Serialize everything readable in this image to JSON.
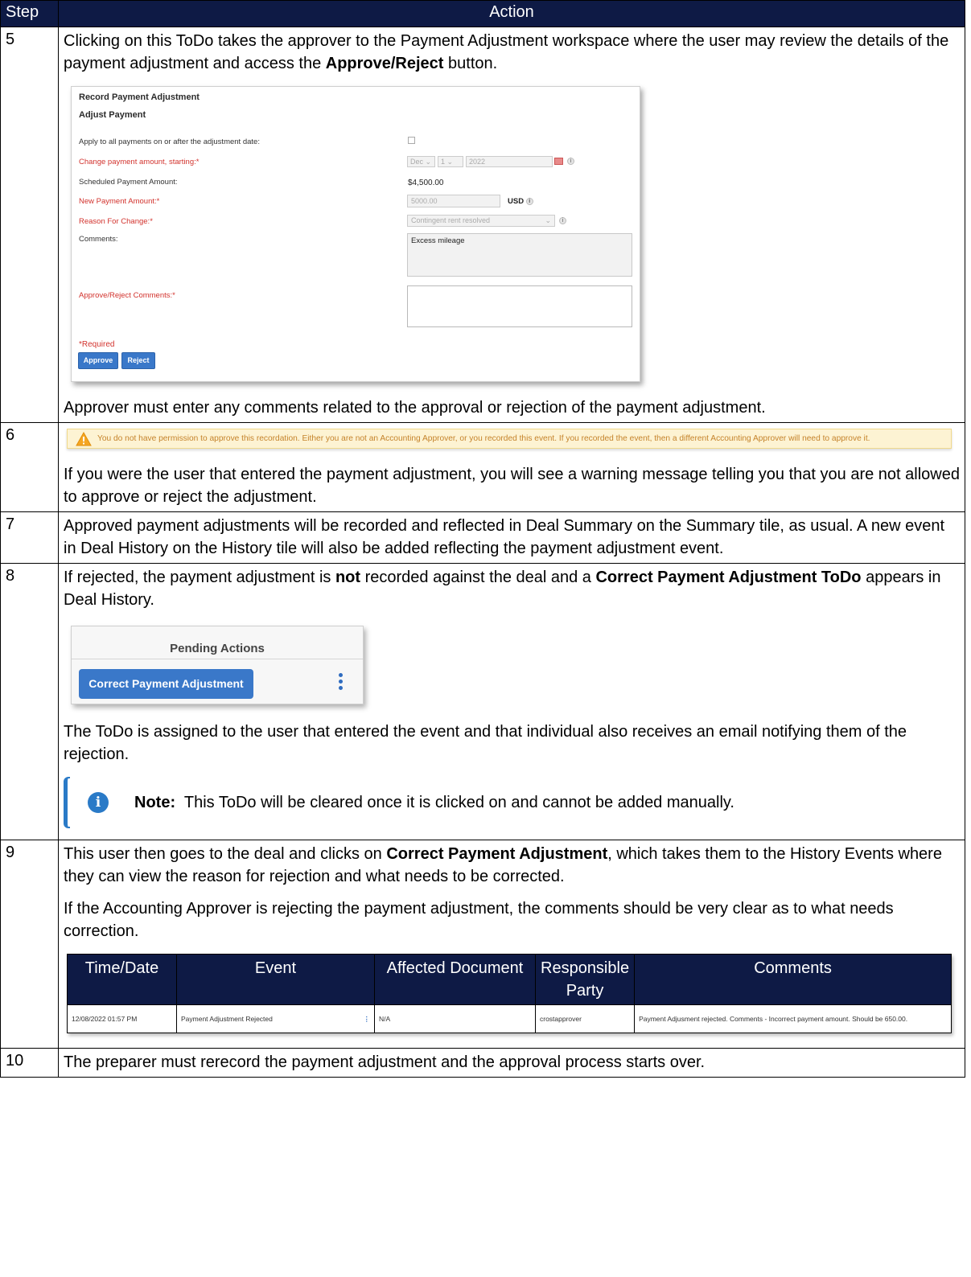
{
  "table": {
    "header_step": "Step",
    "header_action": "Action"
  },
  "steps": {
    "s5": {
      "num": "5",
      "p1_a": "Clicking on this ToDo takes the approver to the Payment Adjustment workspace where the user may review the details of the payment adjustment and access the ",
      "p1_b": "Approve/Reject",
      "p1_c": " button.",
      "p2": "Approver must enter any comments related to the approval or rejection of the payment adjustment."
    },
    "s6": {
      "num": "6",
      "p1": "If you were the user that entered the payment adjustment, you will see a warning message telling you that you are not allowed to approve or reject the adjustment."
    },
    "s7": {
      "num": "7",
      "p1": "Approved payment adjustments will be recorded and reflected in Deal Summary on the Summary tile, as usual. A new event in Deal History on the History tile will also be added reflecting the payment adjustment event."
    },
    "s8": {
      "num": "8",
      "p1_a": "If rejected, the payment adjustment is ",
      "p1_b": "not",
      "p1_c": " recorded against the deal and a ",
      "p1_d": "Correct Payment Adjustment ToDo",
      "p1_e": " appears in Deal History.",
      "p2": "The ToDo is assigned to the user that entered the event and that individual also receives an email notifying them of the rejection.",
      "note_label": "Note:",
      "note_text": "This ToDo will be cleared once it is clicked on and cannot be added manually."
    },
    "s9": {
      "num": "9",
      "p1_a": "This user then goes to the deal and clicks on ",
      "p1_b": "Correct Payment Adjustment",
      "p1_c": ", which takes them to the History Events where they can view the reason for rejection and what needs to be corrected.",
      "p2": "If the Accounting Approver is rejecting the payment adjustment, the comments should be very clear as to what needs correction."
    },
    "s10": {
      "num": "10",
      "p1": "The preparer must rerecord the payment adjustment and the approval process starts over."
    }
  },
  "adjust_form": {
    "title": "Record Payment Adjustment",
    "subtitle": "Adjust Payment",
    "apply_label": "Apply to all payments on or after the adjustment date:",
    "change_label": "Change payment amount, starting:*",
    "month": "Dec",
    "day": "1",
    "year": "2022",
    "scheduled_label": "Scheduled Payment Amount:",
    "scheduled_value": "$4,500.00",
    "new_amount_label": "New Payment Amount:*",
    "new_amount_value": "5000.00",
    "currency": "USD",
    "reason_label": "Reason For Change:*",
    "reason_value": "Contingent rent resolved",
    "comments_label": "Comments:",
    "comments_value": "Excess mileage",
    "approve_comments_label": "Approve/Reject Comments:*",
    "required": "*Required",
    "approve_btn": "Approve",
    "reject_btn": "Reject"
  },
  "warning": {
    "text": "You do not have permission to approve this recordation. Either you are not an Accounting Approver, or you recorded this event. If you recorded the event, then a different Accounting Approver will need to approve it."
  },
  "pending": {
    "title": "Pending Actions",
    "button": "Correct Payment Adjustment"
  },
  "history": {
    "headers": [
      "Time/Date",
      "Event",
      "Affected Document",
      "Responsible Party",
      "Comments"
    ],
    "row": [
      "12/08/2022 01:57 PM",
      "Payment Adjustment Rejected",
      "N/A",
      "crostapprover",
      "Payment Adjusment rejected. Comments - Incorrect payment amount. Should be 650.00."
    ]
  },
  "colors": {
    "header_bg": "#0e1a45",
    "button_blue": "#3a78c9",
    "required_red": "#d2322d",
    "warning_text": "#c5832b",
    "note_blue": "#2a7ac7"
  }
}
